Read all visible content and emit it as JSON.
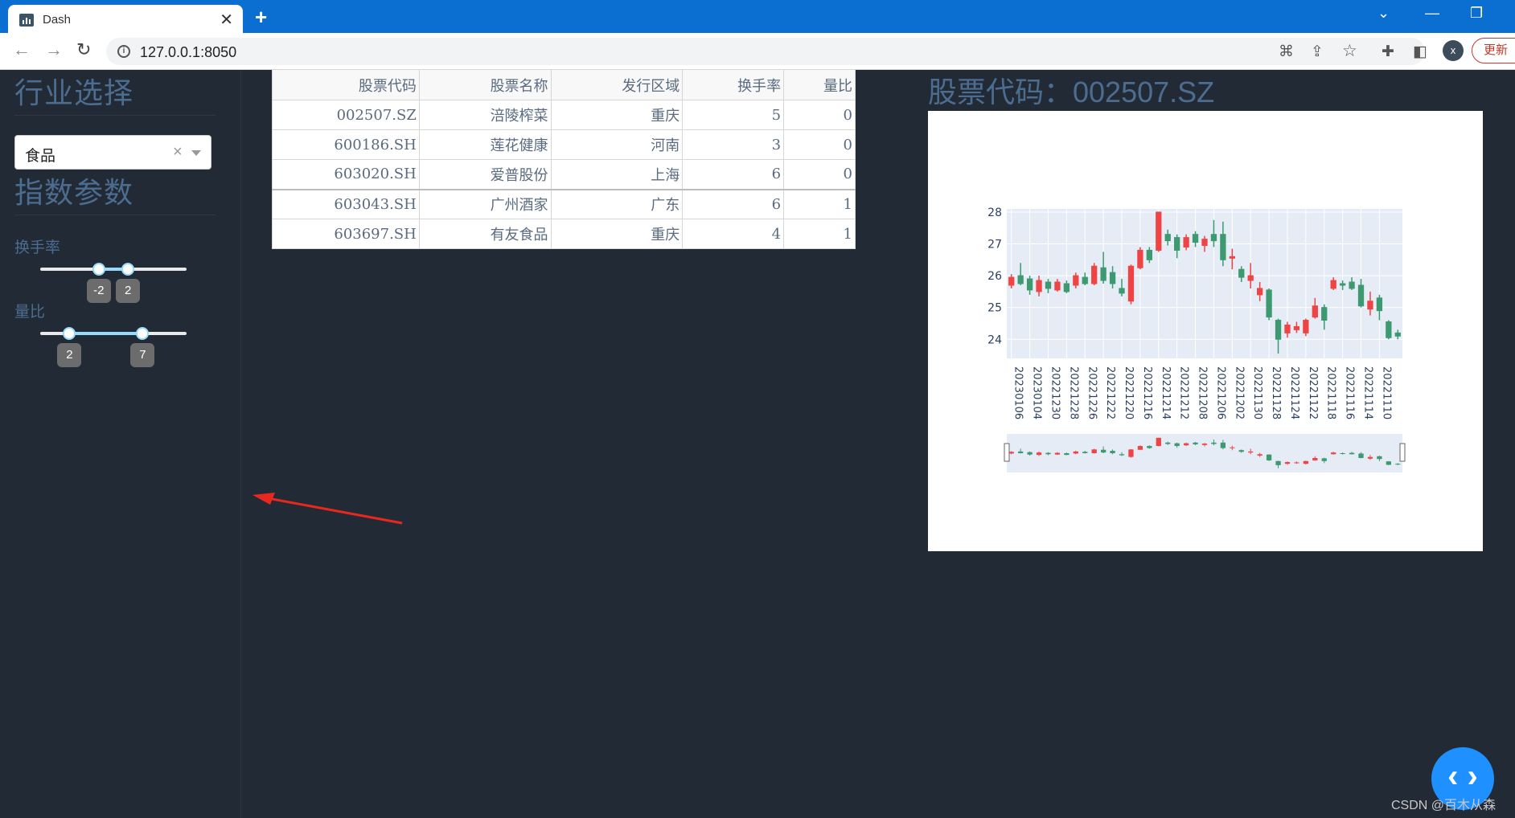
{
  "browser": {
    "tab_title": "Dash",
    "tab_close": "✕",
    "new_tab": "+",
    "url": "127.0.0.1:8050",
    "avatar_letter": "x",
    "update_label": "更新"
  },
  "sidebar": {
    "industry_heading": "行业选择",
    "industry_select": {
      "value": "食品",
      "clear": "×"
    },
    "params_heading": "指数参数",
    "turnover": {
      "label": "换手率",
      "range": [
        -2,
        2
      ],
      "range_min": -10,
      "range_max": 10,
      "low_label": "-2",
      "high_label": "2"
    },
    "volume_ratio": {
      "label": "量比",
      "range": [
        2,
        7
      ],
      "range_min": 0,
      "range_max": 10,
      "low_label": "2",
      "high_label": "7"
    }
  },
  "table": {
    "headers": [
      "股票代码",
      "股票名称",
      "发行区域",
      "换手率",
      "量比"
    ],
    "rows": [
      [
        "002507.SZ",
        "涪陵榨菜",
        "重庆",
        "5",
        "0"
      ],
      [
        "600186.SH",
        "莲花健康",
        "河南",
        "3",
        "0"
      ],
      [
        "603020.SH",
        "爱普股份",
        "上海",
        "6",
        "0"
      ],
      [
        "603043.SH",
        "广州酒家",
        "广东",
        "6",
        "1"
      ],
      [
        "603697.SH",
        "有友食品",
        "重庆",
        "4",
        "1"
      ]
    ]
  },
  "chart_title": "股票代码：002507.SZ",
  "chart_data": {
    "type": "candlestick",
    "y_ticks": [
      24,
      25,
      26,
      27,
      28
    ],
    "ylim": [
      23.4,
      28.1
    ],
    "x_tick_labels": [
      "20230106",
      "20230104",
      "20221230",
      "20221228",
      "20221226",
      "20221222",
      "20221220",
      "20221216",
      "20221214",
      "20221212",
      "20221208",
      "20221206",
      "20221202",
      "20221130",
      "20221128",
      "20221124",
      "20221122",
      "20221118",
      "20221116",
      "20221114",
      "20221110"
    ],
    "up_color": "#ef4444",
    "down_color": "#3d9970",
    "candles": [
      [
        25.7,
        25.95,
        25.6,
        26.05
      ],
      [
        26.0,
        25.75,
        25.7,
        26.4
      ],
      [
        25.9,
        25.55,
        25.4,
        26.0
      ],
      [
        25.5,
        25.85,
        25.35,
        26.0
      ],
      [
        25.8,
        25.6,
        25.45,
        25.9
      ],
      [
        25.55,
        25.8,
        25.5,
        25.9
      ],
      [
        25.75,
        25.5,
        25.45,
        25.85
      ],
      [
        25.7,
        26.0,
        25.6,
        26.1
      ],
      [
        25.95,
        25.75,
        25.7,
        26.1
      ],
      [
        25.75,
        26.3,
        25.7,
        26.4
      ],
      [
        26.25,
        25.85,
        25.75,
        26.75
      ],
      [
        26.1,
        25.75,
        25.6,
        26.3
      ],
      [
        25.6,
        25.45,
        25.35,
        25.9
      ],
      [
        25.2,
        26.3,
        25.1,
        26.35
      ],
      [
        26.25,
        26.8,
        26.2,
        26.9
      ],
      [
        26.8,
        26.5,
        26.4,
        26.9
      ],
      [
        26.8,
        28.0,
        26.75,
        28.0
      ],
      [
        27.3,
        27.1,
        26.95,
        27.45
      ],
      [
        27.2,
        26.8,
        26.55,
        27.3
      ],
      [
        26.9,
        27.2,
        26.8,
        27.3
      ],
      [
        27.3,
        27.05,
        26.9,
        27.4
      ],
      [
        26.95,
        27.15,
        26.75,
        27.25
      ],
      [
        27.3,
        27.1,
        26.9,
        27.75
      ],
      [
        27.3,
        26.5,
        26.3,
        27.7
      ],
      [
        26.55,
        26.6,
        26.2,
        26.85
      ],
      [
        26.2,
        25.95,
        25.8,
        26.3
      ],
      [
        25.85,
        26.0,
        25.6,
        26.4
      ],
      [
        25.4,
        25.6,
        25.2,
        25.8
      ],
      [
        25.55,
        24.7,
        24.6,
        25.6
      ],
      [
        24.6,
        24.0,
        23.55,
        24.65
      ],
      [
        24.2,
        24.45,
        24.05,
        24.55
      ],
      [
        24.3,
        24.4,
        24.2,
        24.55
      ],
      [
        24.2,
        24.6,
        24.1,
        24.65
      ],
      [
        24.7,
        25.05,
        24.65,
        25.3
      ],
      [
        25.0,
        24.6,
        24.3,
        25.1
      ],
      [
        25.6,
        25.85,
        25.55,
        25.95
      ],
      [
        25.75,
        25.7,
        25.55,
        25.85
      ],
      [
        25.8,
        25.6,
        25.55,
        25.95
      ],
      [
        25.7,
        25.05,
        25.0,
        25.9
      ],
      [
        24.95,
        25.2,
        24.75,
        25.5
      ],
      [
        25.3,
        24.9,
        24.6,
        25.4
      ],
      [
        24.55,
        24.05,
        24.0,
        24.6
      ],
      [
        24.2,
        24.1,
        24.0,
        24.3
      ]
    ]
  }
}
